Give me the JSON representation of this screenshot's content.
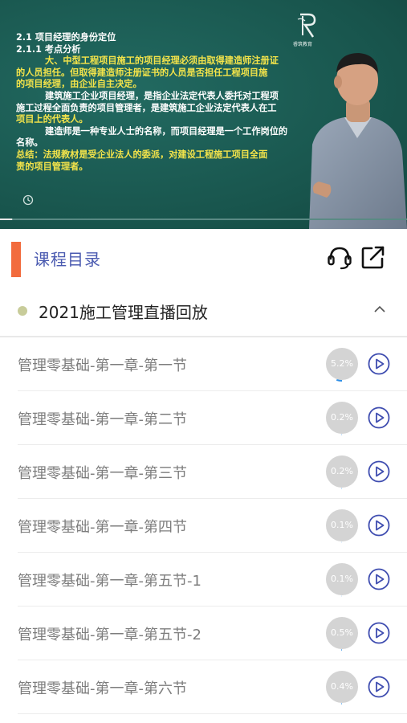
{
  "video": {
    "slide_lines": [
      {
        "text": "2.1 项目经理的身份定位",
        "style": "white"
      },
      {
        "text": "2.1.1 考点分析",
        "style": "white"
      },
      {
        "text": "大、中型工程项目施工的项目经理必须由取得建造师注册证",
        "style": "yellow-indent"
      },
      {
        "text": "的人员担任。但取得建造师注册证书的人员是否担任工程项目施",
        "style": "yellow"
      },
      {
        "text": "的项目经理，由企业自主决定。",
        "style": "yellow"
      },
      {
        "text": "建筑施工企业项目经理，是指企业法定代表人委托对工程项",
        "style": "white-indent"
      },
      {
        "text": "施工过程全面负责的项目管理者，是建筑施工企业法定代表人在工",
        "style": "white"
      },
      {
        "text": "项目上的代表人。",
        "style": "yellow"
      },
      {
        "text": "建造师是一种专业人士的名称，而项目经理是一个工作岗位的",
        "style": "white-indent"
      },
      {
        "text": "名称。",
        "style": "white"
      },
      {
        "text": "总结：法规教材是受企业法人的委派，对建设工程施工项目全面",
        "style": "yellow"
      },
      {
        "text": "责的项目管理者。",
        "style": "yellow"
      }
    ],
    "logo_text": "睿筑教育",
    "progress_played_fraction": 0.03
  },
  "catalog": {
    "title": "课程目录",
    "headset_icon": "headset-icon",
    "share_icon": "share-icon"
  },
  "section": {
    "title": "2021施工管理直播回放",
    "dot_color": "#c8cc9a"
  },
  "lessons": [
    {
      "title": "管理零基础-第一章-第一节",
      "progress_label": "5.2%",
      "progress": 0.052
    },
    {
      "title": "管理零基础-第一章-第二节",
      "progress_label": "0.2%",
      "progress": 0.002
    },
    {
      "title": "管理零基础-第一章-第三节",
      "progress_label": "0.2%",
      "progress": 0.002
    },
    {
      "title": "管理零基础-第一章-第四节",
      "progress_label": "0.1%",
      "progress": 0.001
    },
    {
      "title": "管理零基础-第一章-第五节-1",
      "progress_label": "0.1%",
      "progress": 0.001
    },
    {
      "title": "管理零基础-第一章-第五节-2",
      "progress_label": "0.5%",
      "progress": 0.005
    },
    {
      "title": "管理零基础-第一章-第六节",
      "progress_label": "0.4%",
      "progress": 0.004
    }
  ],
  "colors": {
    "accent_bar": "#f26b3d",
    "title_blue": "#4a5ab0",
    "play_blue": "#3f4db0",
    "progress_blue": "#2f8fe6"
  }
}
